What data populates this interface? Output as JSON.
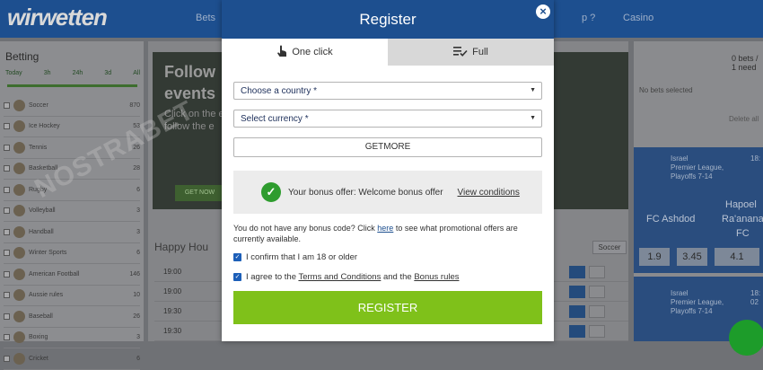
{
  "background": {
    "logo": "wirwetten",
    "nav": [
      "Bets",
      "p ?",
      "Casino"
    ],
    "sidebar": {
      "title": "Betting",
      "time_tabs": [
        "Today",
        "3h",
        "24h",
        "3d",
        "All"
      ],
      "sports": [
        {
          "name": "Soccer",
          "count": "870"
        },
        {
          "name": "Ice Hockey",
          "count": "53"
        },
        {
          "name": "Tennis",
          "count": "26"
        },
        {
          "name": "Basketball",
          "count": "28"
        },
        {
          "name": "Rugby",
          "count": "6"
        },
        {
          "name": "Volleyball",
          "count": "3"
        },
        {
          "name": "Handball",
          "count": "3"
        },
        {
          "name": "Winter Sports",
          "count": "6"
        },
        {
          "name": "American Football",
          "count": "146"
        },
        {
          "name": "Aussie rules",
          "count": "10"
        },
        {
          "name": "Baseball",
          "count": "26"
        },
        {
          "name": "Boxing",
          "count": "3"
        },
        {
          "name": "Cricket",
          "count": "6"
        }
      ]
    },
    "banner": {
      "headline_1": "Follow",
      "headline_2": "events",
      "sub_1": "Click on the e",
      "sub_2": "follow the e",
      "button": "GET NOW"
    },
    "happy_hour": "Happy Hou",
    "soccer_chip": "Soccer",
    "match_times": [
      "19:00",
      "19:00",
      "19:30",
      "19:30"
    ],
    "betslip": {
      "count": "0 bets / 1 need",
      "no_bets": "No bets selected",
      "delete": "Delete all"
    },
    "match1": {
      "team": "Israel",
      "league": "Premier League,",
      "stage": "Playoffs 7-14",
      "time": "18:",
      "home": "FC Ashdod",
      "away_1": "Hapoel",
      "away_2": "Ra'anana",
      "away_3": "FC",
      "odds": [
        "1.9",
        "3.45",
        "4.1"
      ]
    },
    "match2": {
      "team": "Israel",
      "league": "Premier League,",
      "stage": "Playoffs 7-14",
      "time": "18:",
      "time2": "02"
    },
    "watermark": "NOSTRABET"
  },
  "modal": {
    "title": "Register",
    "close_symbol": "×",
    "tabs": [
      {
        "label": "One click",
        "icon": "hand-pointer-icon",
        "active": true
      },
      {
        "label": "Full",
        "icon": "list-check-icon",
        "active": false
      }
    ],
    "country_placeholder": "Choose a country *",
    "currency_placeholder": "Select currency *",
    "promo_code": "GETMORE",
    "bonus": {
      "text": "Your bonus offer: Welcome bonus offer",
      "link": "View conditions"
    },
    "bonus_code": {
      "prefix": "You do not have any bonus code? Click",
      "link": "here",
      "suffix": "to see what promotional offers are currently available."
    },
    "confirm_age": "I confirm that I am 18 or older",
    "terms": {
      "prefix": "I agree to the",
      "terms_link": "Terms and Conditions",
      "middle": "and the",
      "bonus_link": "Bonus rules"
    },
    "register_button": "REGISTER"
  },
  "colors": {
    "brand_blue": "#1d4f8f",
    "register_green": "#7fc11a",
    "check_green": "#2e9c2e",
    "checkbox_blue": "#1d5fb8"
  }
}
